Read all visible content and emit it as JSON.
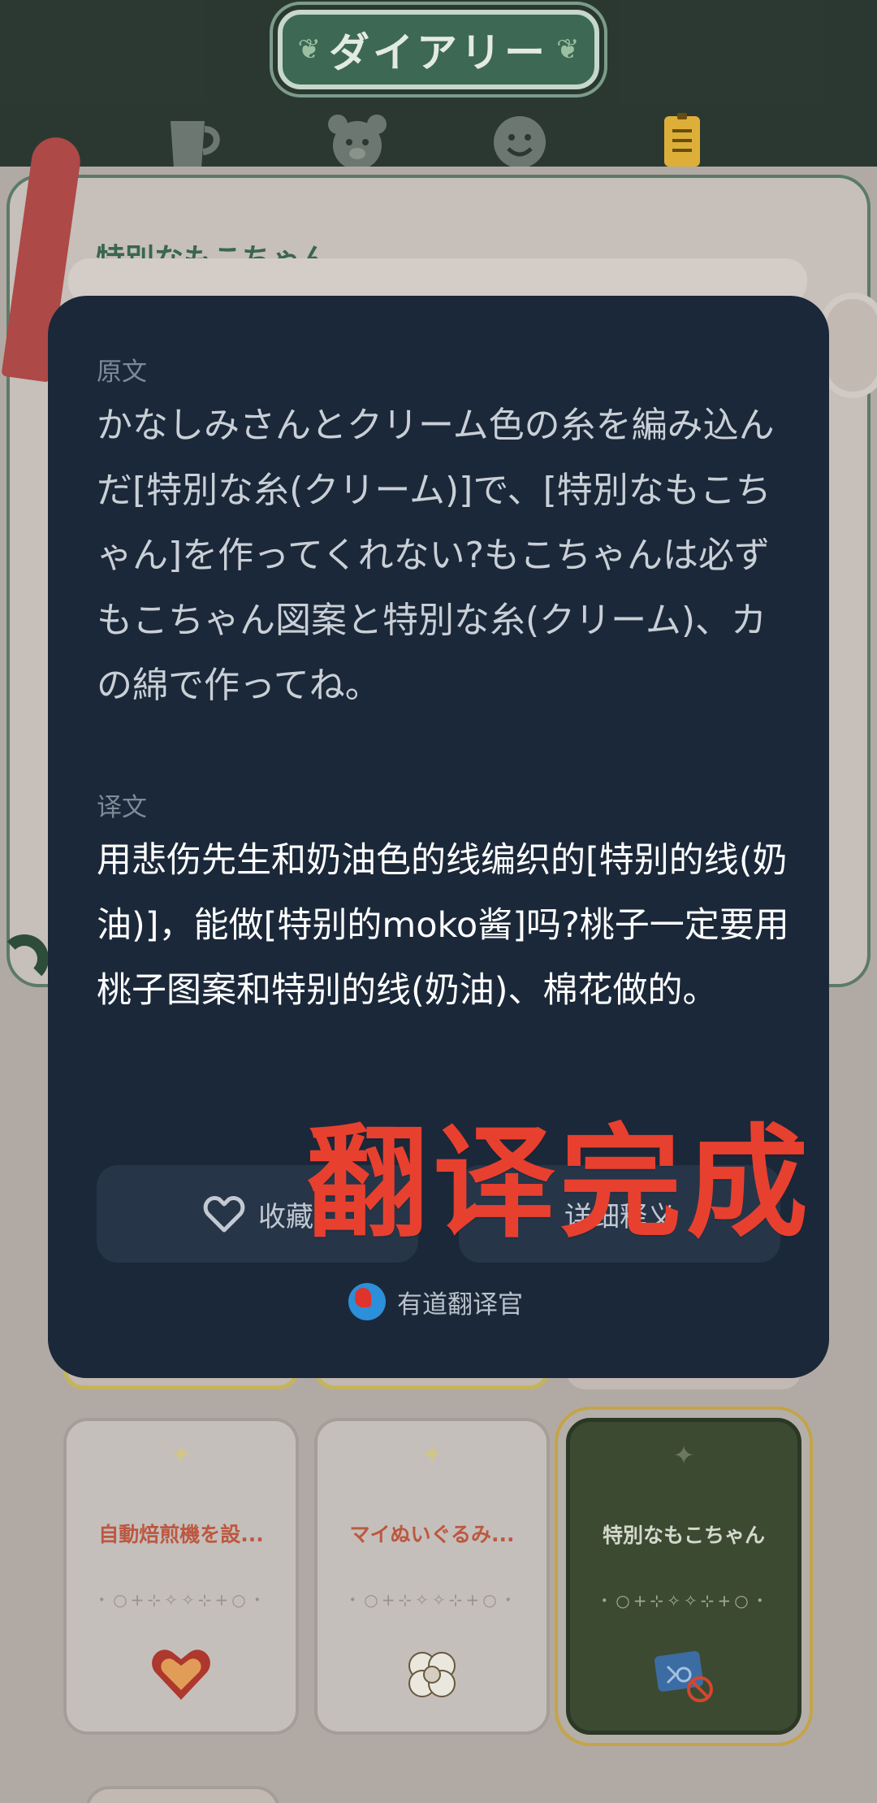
{
  "header": {
    "title": "ダイアリー",
    "tabs": [
      {
        "icon": "cup-icon"
      },
      {
        "icon": "bear-icon"
      },
      {
        "icon": "smiley-icon"
      },
      {
        "icon": "diary-icon",
        "active": true
      }
    ]
  },
  "page": {
    "title": "特別なもこちゃん"
  },
  "cards": [
    {
      "title": "自動焙煎機を設...",
      "item_icon": "heart-icon"
    },
    {
      "title": "マイぬいぐるみ...",
      "item_icon": "cotton-icon"
    },
    {
      "title": "特別なもこちゃん",
      "item_icon": "fabric-locked-icon",
      "selected": true
    }
  ],
  "card_deco": "・○+⊹✧✧⊹+○・",
  "translation_panel": {
    "original_label": "原文",
    "original_text": "かなしみさんとクリーム色の糸を編み込んだ[特別な糸(クリーム)]で、[特別なもこちゃん]を作ってくれない?もこちゃんは必ずもこちゃん図案と特別な糸(クリーム)、カの綿で作ってね。",
    "translation_label": "译文",
    "translation_text": "用悲伤先生和奶油色的线编织的[特别的线(奶油)]，能做[特别的moko酱]吗?桃子一定要用桃子图案和特别的线(奶油)、棉花做的。",
    "favorite_label": "收藏",
    "detail_label": "详细释义",
    "brand": "有道翻译官"
  },
  "overlay_text": "翻译完成",
  "colors": {
    "panel_bg": "#1b2839",
    "stamp_red": "#e8402f",
    "header_green": "#2c3a33"
  }
}
